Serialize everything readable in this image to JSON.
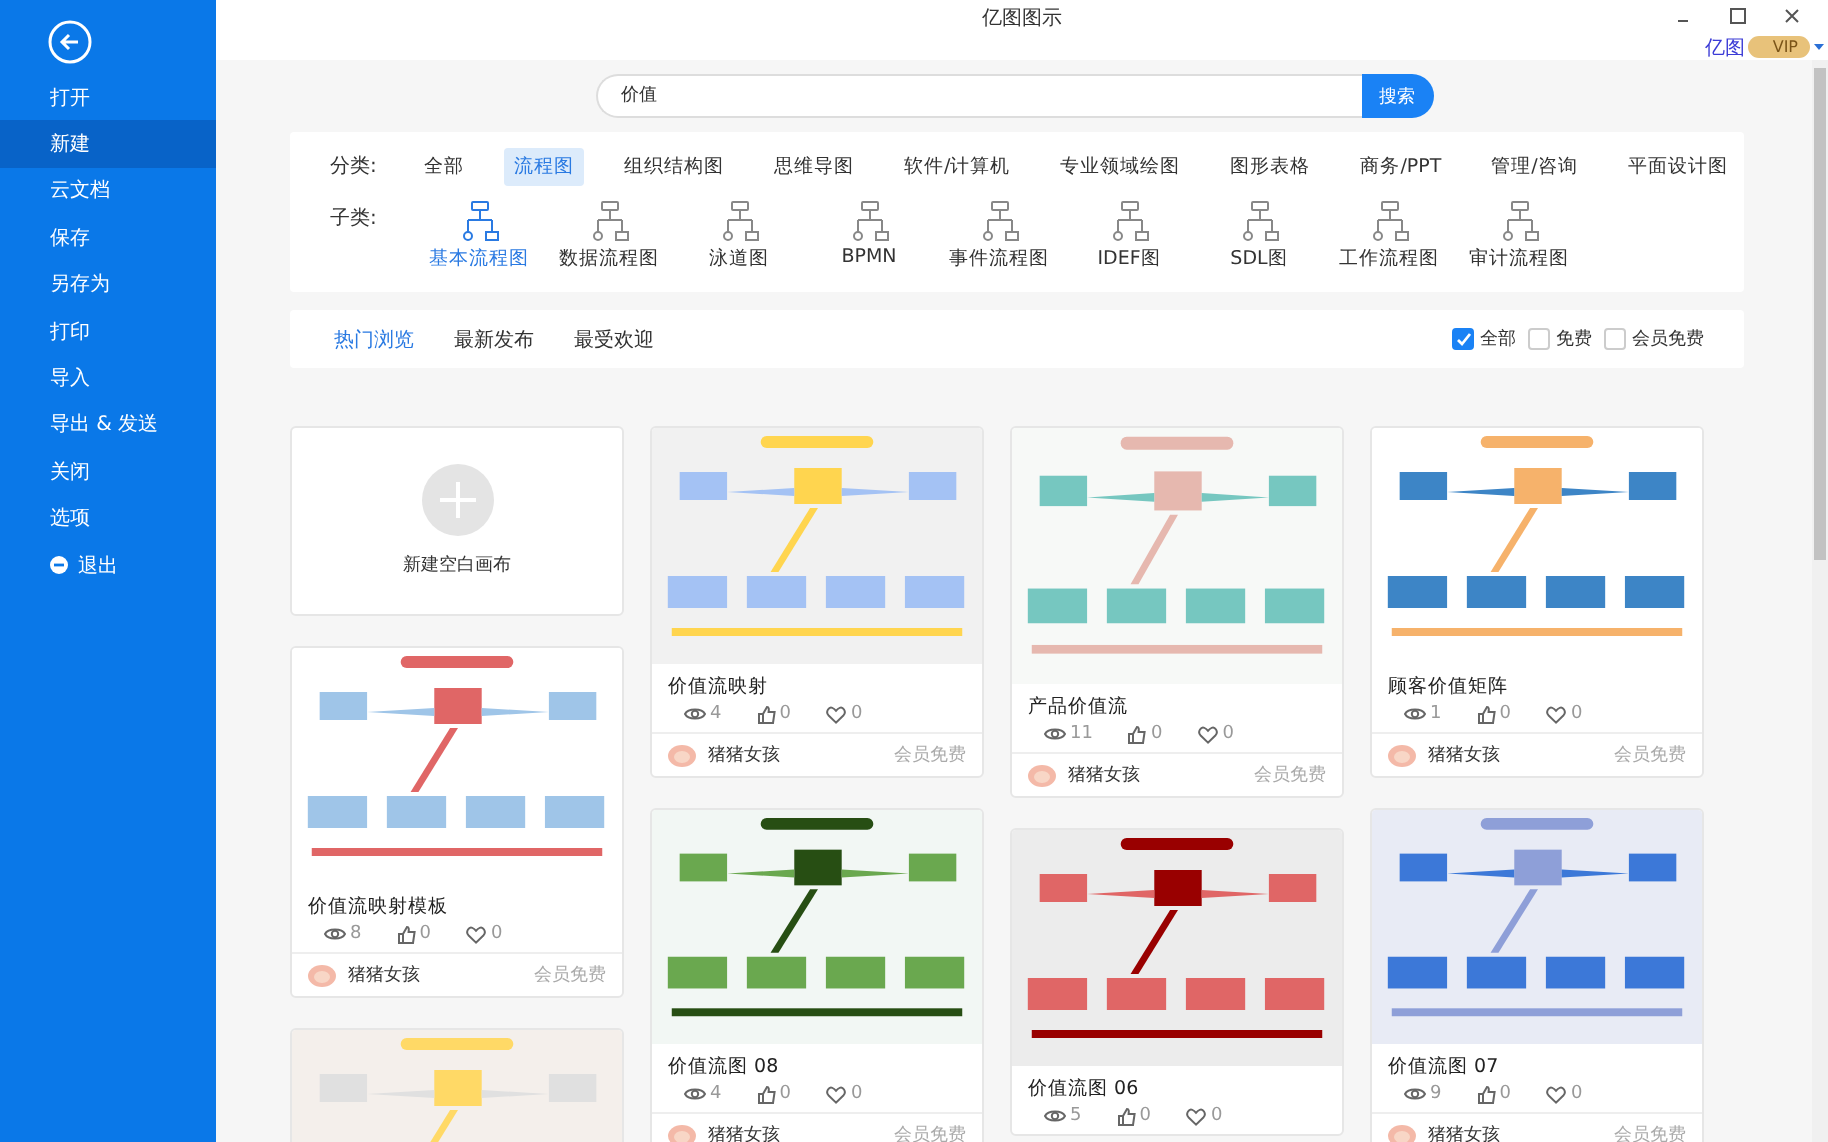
{
  "window": {
    "title": "亿图图示"
  },
  "account": {
    "brand": "亿图",
    "badge": "VIP"
  },
  "sidebar": {
    "items": [
      {
        "label": "打开",
        "selected": false,
        "kind": "plain"
      },
      {
        "label": "新建",
        "selected": true,
        "kind": "plain"
      },
      {
        "label": "云文档",
        "selected": false,
        "kind": "plain"
      },
      {
        "label": "保存",
        "selected": false,
        "kind": "plain"
      },
      {
        "label": "另存为",
        "selected": false,
        "kind": "plain"
      },
      {
        "label": "打印",
        "selected": false,
        "kind": "plain"
      },
      {
        "label": "导入",
        "selected": false,
        "kind": "plain"
      },
      {
        "label": "导出 & 发送",
        "selected": false,
        "kind": "plain"
      },
      {
        "label": "关闭",
        "selected": false,
        "kind": "plain"
      },
      {
        "label": "选项",
        "selected": false,
        "kind": "plain"
      },
      {
        "label": "退出",
        "selected": false,
        "kind": "exit"
      }
    ]
  },
  "search": {
    "value": "价值",
    "button": "搜索"
  },
  "categories": {
    "label": "分类:",
    "items": [
      {
        "label": "全部",
        "selected": false
      },
      {
        "label": "流程图",
        "selected": true
      },
      {
        "label": "组织结构图",
        "selected": false
      },
      {
        "label": "思维导图",
        "selected": false
      },
      {
        "label": "软件/计算机",
        "selected": false
      },
      {
        "label": "专业领域绘图",
        "selected": false
      },
      {
        "label": "图形表格",
        "selected": false
      },
      {
        "label": "商务/PPT",
        "selected": false
      },
      {
        "label": "管理/咨询",
        "selected": false
      },
      {
        "label": "平面设计图",
        "selected": false
      }
    ]
  },
  "subcategories": {
    "label": "子类:",
    "items": [
      {
        "label": "基本流程图",
        "selected": true
      },
      {
        "label": "数据流程图",
        "selected": false
      },
      {
        "label": "泳道图",
        "selected": false
      },
      {
        "label": "BPMN",
        "selected": false
      },
      {
        "label": "事件流程图",
        "selected": false
      },
      {
        "label": "IDEF图",
        "selected": false
      },
      {
        "label": "SDL图",
        "selected": false
      },
      {
        "label": "工作流程图",
        "selected": false
      },
      {
        "label": "审计流程图",
        "selected": false
      }
    ]
  },
  "sort_tabs": [
    {
      "label": "热门浏览",
      "selected": true
    },
    {
      "label": "最新发布",
      "selected": false
    },
    {
      "label": "最受欢迎",
      "selected": false
    }
  ],
  "filters": [
    {
      "label": "全部",
      "checked": true
    },
    {
      "label": "免费",
      "checked": false
    },
    {
      "label": "会员免费",
      "checked": false
    }
  ],
  "cards": {
    "columns": [
      [
        {
          "kind": "blank",
          "label": "新建空白画布"
        },
        {
          "kind": "template",
          "title": "价值流映射模板",
          "views": "8",
          "likes": "0",
          "favorites": "0",
          "author": "猪猪女孩",
          "price": "会员免费"
        },
        {
          "kind": "picture"
        }
      ],
      [
        {
          "kind": "template",
          "title": "价值流映射",
          "views": "4",
          "likes": "0",
          "favorites": "0",
          "author": "猪猪女孩",
          "price": "会员免费"
        },
        {
          "kind": "template",
          "title": "价值流图 08",
          "views": "4",
          "likes": "0",
          "favorites": "0",
          "author": "猪猪女孩",
          "price": "会员免费"
        }
      ],
      [
        {
          "kind": "template",
          "title": "产品价值流",
          "views": "11",
          "likes": "0",
          "favorites": "0",
          "author": "猪猪女孩",
          "price": "会员免费"
        },
        {
          "kind": "template",
          "title": "价值流图 06",
          "views": "5",
          "likes": "0",
          "favorites": "0"
        }
      ],
      [
        {
          "kind": "template",
          "title": "顾客价值矩阵",
          "views": "1",
          "likes": "0",
          "favorites": "0",
          "author": "猪猪女孩",
          "price": "会员免费"
        },
        {
          "kind": "template",
          "title": "价值流图 07",
          "views": "9",
          "likes": "0",
          "favorites": "0",
          "author": "猪猪女孩",
          "price": "会员免费"
        }
      ]
    ]
  }
}
